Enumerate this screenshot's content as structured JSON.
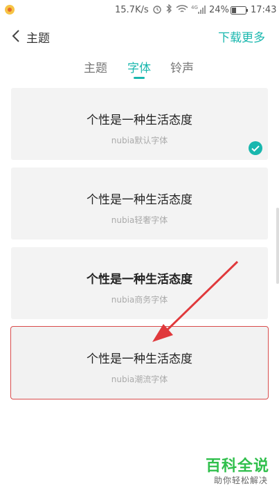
{
  "status_bar": {
    "network_speed": "15.7K/s",
    "network_type": "4G",
    "battery_percent": "24%",
    "time": "17:43",
    "icons": [
      "app-badge-icon",
      "alarm-icon",
      "bluetooth-icon",
      "wifi-icon",
      "signal-4g-icon",
      "battery-icon"
    ]
  },
  "header": {
    "title": "主题",
    "download_more": "下载更多"
  },
  "tabs": [
    {
      "label": "主题",
      "active": false
    },
    {
      "label": "字体",
      "active": true
    },
    {
      "label": "铃声",
      "active": false
    }
  ],
  "fonts": [
    {
      "sample": "个性是一种生活态度",
      "name": "nubia默认字体",
      "selected": true
    },
    {
      "sample": "个性是一种生活态度",
      "name": "nubia轻奢字体",
      "selected": false
    },
    {
      "sample": "个性是一种生活态度",
      "name": "nubia商务字体",
      "selected": false
    },
    {
      "sample": "个性是一种生活态度",
      "name": "nubia潮流字体",
      "selected": false
    }
  ],
  "watermark": {
    "title": "百科全说",
    "subtitle": "助你轻松解决"
  },
  "colors": {
    "accent": "#19b7ae",
    "card_bg": "#f3f3f3",
    "highlight_border": "#d84a4a",
    "arrow": "#e0393c"
  }
}
